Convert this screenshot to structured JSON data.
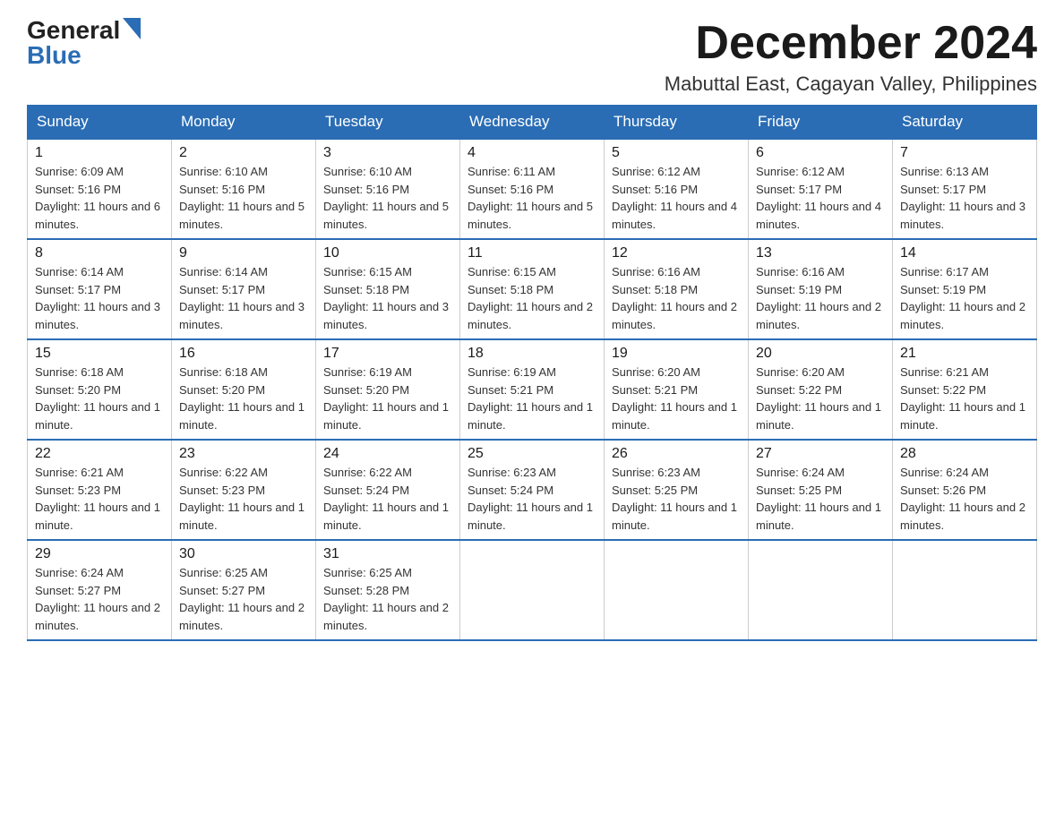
{
  "logo": {
    "general": "General",
    "blue": "Blue"
  },
  "title": "December 2024",
  "location": "Mabuttal East, Cagayan Valley, Philippines",
  "days_of_week": [
    "Sunday",
    "Monday",
    "Tuesday",
    "Wednesday",
    "Thursday",
    "Friday",
    "Saturday"
  ],
  "weeks": [
    [
      {
        "day": "1",
        "sunrise": "Sunrise: 6:09 AM",
        "sunset": "Sunset: 5:16 PM",
        "daylight": "Daylight: 11 hours and 6 minutes."
      },
      {
        "day": "2",
        "sunrise": "Sunrise: 6:10 AM",
        "sunset": "Sunset: 5:16 PM",
        "daylight": "Daylight: 11 hours and 5 minutes."
      },
      {
        "day": "3",
        "sunrise": "Sunrise: 6:10 AM",
        "sunset": "Sunset: 5:16 PM",
        "daylight": "Daylight: 11 hours and 5 minutes."
      },
      {
        "day": "4",
        "sunrise": "Sunrise: 6:11 AM",
        "sunset": "Sunset: 5:16 PM",
        "daylight": "Daylight: 11 hours and 5 minutes."
      },
      {
        "day": "5",
        "sunrise": "Sunrise: 6:12 AM",
        "sunset": "Sunset: 5:16 PM",
        "daylight": "Daylight: 11 hours and 4 minutes."
      },
      {
        "day": "6",
        "sunrise": "Sunrise: 6:12 AM",
        "sunset": "Sunset: 5:17 PM",
        "daylight": "Daylight: 11 hours and 4 minutes."
      },
      {
        "day": "7",
        "sunrise": "Sunrise: 6:13 AM",
        "sunset": "Sunset: 5:17 PM",
        "daylight": "Daylight: 11 hours and 3 minutes."
      }
    ],
    [
      {
        "day": "8",
        "sunrise": "Sunrise: 6:14 AM",
        "sunset": "Sunset: 5:17 PM",
        "daylight": "Daylight: 11 hours and 3 minutes."
      },
      {
        "day": "9",
        "sunrise": "Sunrise: 6:14 AM",
        "sunset": "Sunset: 5:17 PM",
        "daylight": "Daylight: 11 hours and 3 minutes."
      },
      {
        "day": "10",
        "sunrise": "Sunrise: 6:15 AM",
        "sunset": "Sunset: 5:18 PM",
        "daylight": "Daylight: 11 hours and 3 minutes."
      },
      {
        "day": "11",
        "sunrise": "Sunrise: 6:15 AM",
        "sunset": "Sunset: 5:18 PM",
        "daylight": "Daylight: 11 hours and 2 minutes."
      },
      {
        "day": "12",
        "sunrise": "Sunrise: 6:16 AM",
        "sunset": "Sunset: 5:18 PM",
        "daylight": "Daylight: 11 hours and 2 minutes."
      },
      {
        "day": "13",
        "sunrise": "Sunrise: 6:16 AM",
        "sunset": "Sunset: 5:19 PM",
        "daylight": "Daylight: 11 hours and 2 minutes."
      },
      {
        "day": "14",
        "sunrise": "Sunrise: 6:17 AM",
        "sunset": "Sunset: 5:19 PM",
        "daylight": "Daylight: 11 hours and 2 minutes."
      }
    ],
    [
      {
        "day": "15",
        "sunrise": "Sunrise: 6:18 AM",
        "sunset": "Sunset: 5:20 PM",
        "daylight": "Daylight: 11 hours and 1 minute."
      },
      {
        "day": "16",
        "sunrise": "Sunrise: 6:18 AM",
        "sunset": "Sunset: 5:20 PM",
        "daylight": "Daylight: 11 hours and 1 minute."
      },
      {
        "day": "17",
        "sunrise": "Sunrise: 6:19 AM",
        "sunset": "Sunset: 5:20 PM",
        "daylight": "Daylight: 11 hours and 1 minute."
      },
      {
        "day": "18",
        "sunrise": "Sunrise: 6:19 AM",
        "sunset": "Sunset: 5:21 PM",
        "daylight": "Daylight: 11 hours and 1 minute."
      },
      {
        "day": "19",
        "sunrise": "Sunrise: 6:20 AM",
        "sunset": "Sunset: 5:21 PM",
        "daylight": "Daylight: 11 hours and 1 minute."
      },
      {
        "day": "20",
        "sunrise": "Sunrise: 6:20 AM",
        "sunset": "Sunset: 5:22 PM",
        "daylight": "Daylight: 11 hours and 1 minute."
      },
      {
        "day": "21",
        "sunrise": "Sunrise: 6:21 AM",
        "sunset": "Sunset: 5:22 PM",
        "daylight": "Daylight: 11 hours and 1 minute."
      }
    ],
    [
      {
        "day": "22",
        "sunrise": "Sunrise: 6:21 AM",
        "sunset": "Sunset: 5:23 PM",
        "daylight": "Daylight: 11 hours and 1 minute."
      },
      {
        "day": "23",
        "sunrise": "Sunrise: 6:22 AM",
        "sunset": "Sunset: 5:23 PM",
        "daylight": "Daylight: 11 hours and 1 minute."
      },
      {
        "day": "24",
        "sunrise": "Sunrise: 6:22 AM",
        "sunset": "Sunset: 5:24 PM",
        "daylight": "Daylight: 11 hours and 1 minute."
      },
      {
        "day": "25",
        "sunrise": "Sunrise: 6:23 AM",
        "sunset": "Sunset: 5:24 PM",
        "daylight": "Daylight: 11 hours and 1 minute."
      },
      {
        "day": "26",
        "sunrise": "Sunrise: 6:23 AM",
        "sunset": "Sunset: 5:25 PM",
        "daylight": "Daylight: 11 hours and 1 minute."
      },
      {
        "day": "27",
        "sunrise": "Sunrise: 6:24 AM",
        "sunset": "Sunset: 5:25 PM",
        "daylight": "Daylight: 11 hours and 1 minute."
      },
      {
        "day": "28",
        "sunrise": "Sunrise: 6:24 AM",
        "sunset": "Sunset: 5:26 PM",
        "daylight": "Daylight: 11 hours and 2 minutes."
      }
    ],
    [
      {
        "day": "29",
        "sunrise": "Sunrise: 6:24 AM",
        "sunset": "Sunset: 5:27 PM",
        "daylight": "Daylight: 11 hours and 2 minutes."
      },
      {
        "day": "30",
        "sunrise": "Sunrise: 6:25 AM",
        "sunset": "Sunset: 5:27 PM",
        "daylight": "Daylight: 11 hours and 2 minutes."
      },
      {
        "day": "31",
        "sunrise": "Sunrise: 6:25 AM",
        "sunset": "Sunset: 5:28 PM",
        "daylight": "Daylight: 11 hours and 2 minutes."
      },
      {
        "day": "",
        "sunrise": "",
        "sunset": "",
        "daylight": ""
      },
      {
        "day": "",
        "sunrise": "",
        "sunset": "",
        "daylight": ""
      },
      {
        "day": "",
        "sunrise": "",
        "sunset": "",
        "daylight": ""
      },
      {
        "day": "",
        "sunrise": "",
        "sunset": "",
        "daylight": ""
      }
    ]
  ]
}
